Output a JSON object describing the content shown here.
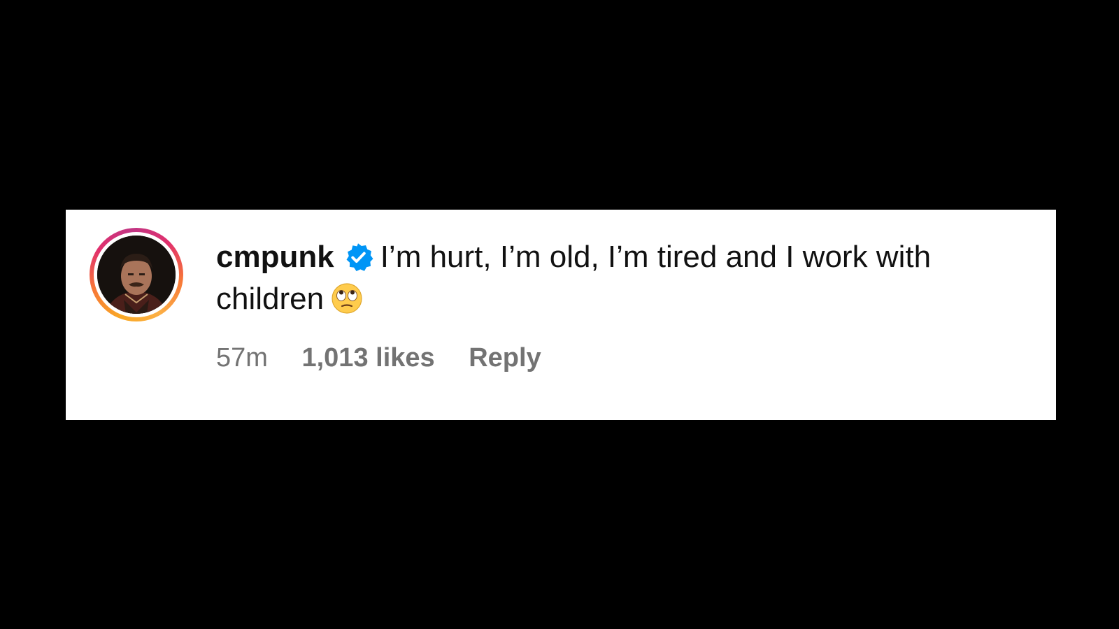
{
  "comment": {
    "username": "cmpunk",
    "verified": true,
    "text": "I’m hurt, I’m old, I’m tired and I work with children",
    "emoji": "face-with-rolling-eyes",
    "time_ago": "57m",
    "likes": "1,013 likes",
    "reply_label": "Reply"
  },
  "colors": {
    "background": "#000000",
    "card": "#ffffff",
    "text": "#111111",
    "meta": "#737373",
    "verified": "#0095f6"
  },
  "icons": {
    "avatar": "profile-avatar",
    "badge": "verified-badge-icon",
    "emoji": "rolling-eyes-emoji-icon"
  }
}
